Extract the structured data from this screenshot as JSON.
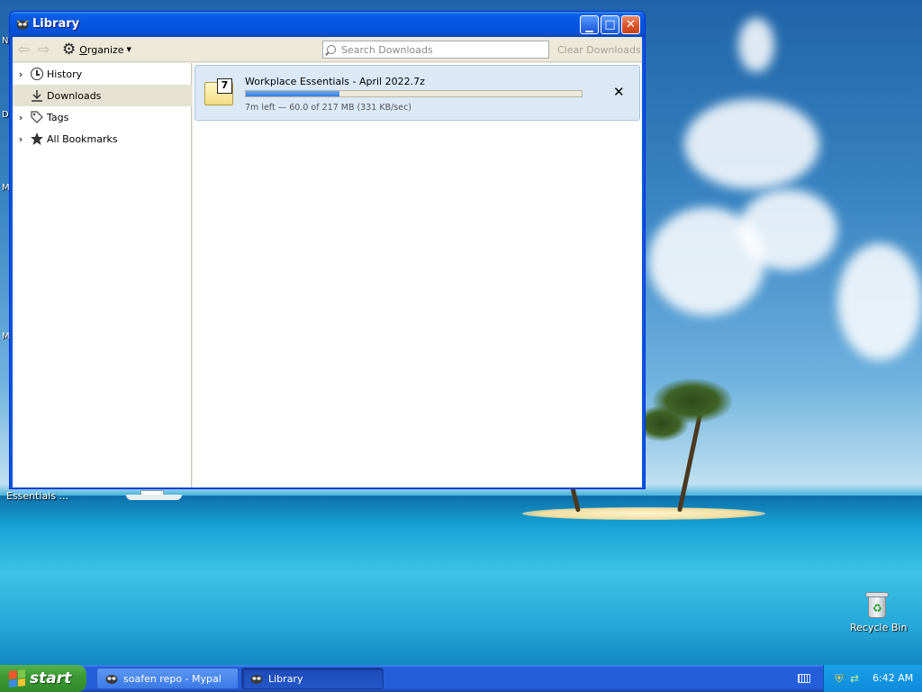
{
  "window": {
    "title": "Library",
    "controls": {
      "minimize": "minimize-icon",
      "maximize": "maximize-icon",
      "close": "close-icon"
    }
  },
  "toolbar": {
    "organize_label": "Organize",
    "search_placeholder": "Search Downloads",
    "search_value": "",
    "clear_label": "Clear Downloads"
  },
  "sidebar": {
    "items": [
      {
        "label": "History",
        "icon": "clock-icon",
        "expandable": true,
        "selected": false
      },
      {
        "label": "Downloads",
        "icon": "download-icon",
        "expandable": false,
        "selected": true
      },
      {
        "label": "Tags",
        "icon": "tag-icon",
        "expandable": true,
        "selected": false
      },
      {
        "label": "All Bookmarks",
        "icon": "star-icon",
        "expandable": true,
        "selected": false
      }
    ]
  },
  "downloads": [
    {
      "filename": "Workplace Essentials - April 2022.7z",
      "status": "7m left — 60.0 of 217 MB (331 KB/sec)",
      "progress": 0.28,
      "icon": "7z-archive-icon"
    }
  ],
  "desktop": {
    "left_letters": [
      "N",
      "D",
      "M",
      "M"
    ],
    "essentials_label": "Essentials ...",
    "recycle_bin_label": "Recycle Bin"
  },
  "taskbar": {
    "start_label": "start",
    "tasks": [
      {
        "label": "soafen repo - Mypal",
        "active": false
      },
      {
        "label": "Library",
        "active": true
      }
    ],
    "clock": "6:42 AM"
  },
  "colors": {
    "title_bar": "#0554e2",
    "selected_sidebar": "#e6e2d2",
    "download_row": "#dbe9f7",
    "progress_fill": "#3581e3",
    "taskbar": "#245edb",
    "start_button": "#3c9a35"
  }
}
